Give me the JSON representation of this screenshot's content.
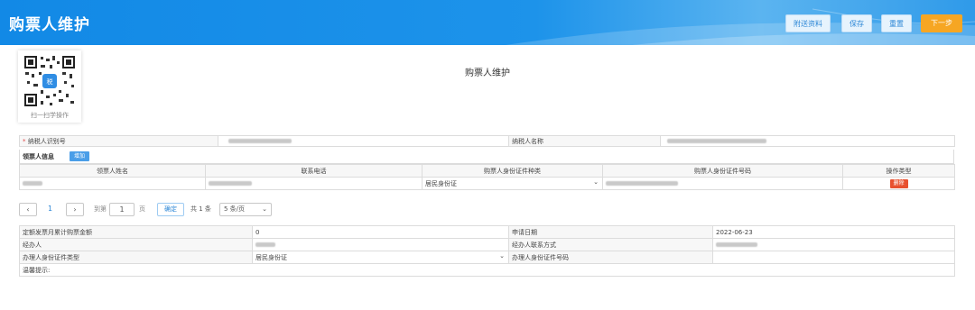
{
  "header": {
    "title": "购票人维护",
    "buttons": {
      "attachments": "附送资料",
      "save": "保存",
      "reset": "重置",
      "next": "下一步"
    }
  },
  "qr": {
    "caption": "扫一扫学操作"
  },
  "page_title": "购票人维护",
  "taxpayer": {
    "id_label": "纳税人识别号",
    "required_mark": "*",
    "name_label": "纳税人名称"
  },
  "recipient_section": {
    "title": "领票人信息",
    "add_label": "增加",
    "columns": [
      "领票人姓名",
      "联系电话",
      "购票人身份证件种类",
      "购票人身份证件号码",
      "操作类型"
    ],
    "row": {
      "id_type": "居民身份证",
      "delete_label": "删除"
    }
  },
  "pagination": {
    "current_page": "1",
    "goto_label": "到第",
    "goto_value": "1",
    "page_unit": "页",
    "confirm_label": "确定",
    "total_label": "共 1 条",
    "page_size": "5 条/页"
  },
  "details": {
    "amount_label": "定额发票月累计购票金额",
    "amount_value": "0",
    "date_label": "申请日期",
    "date_value": "2022-06-23",
    "handler_label": "经办人",
    "contact_label": "经办人联系方式",
    "handler_id_type_label": "办理人身份证件类型",
    "handler_id_type_value": "居民身份证",
    "handler_id_no_label": "办理人身份证件号码",
    "tip_label": "温馨提示:"
  }
}
